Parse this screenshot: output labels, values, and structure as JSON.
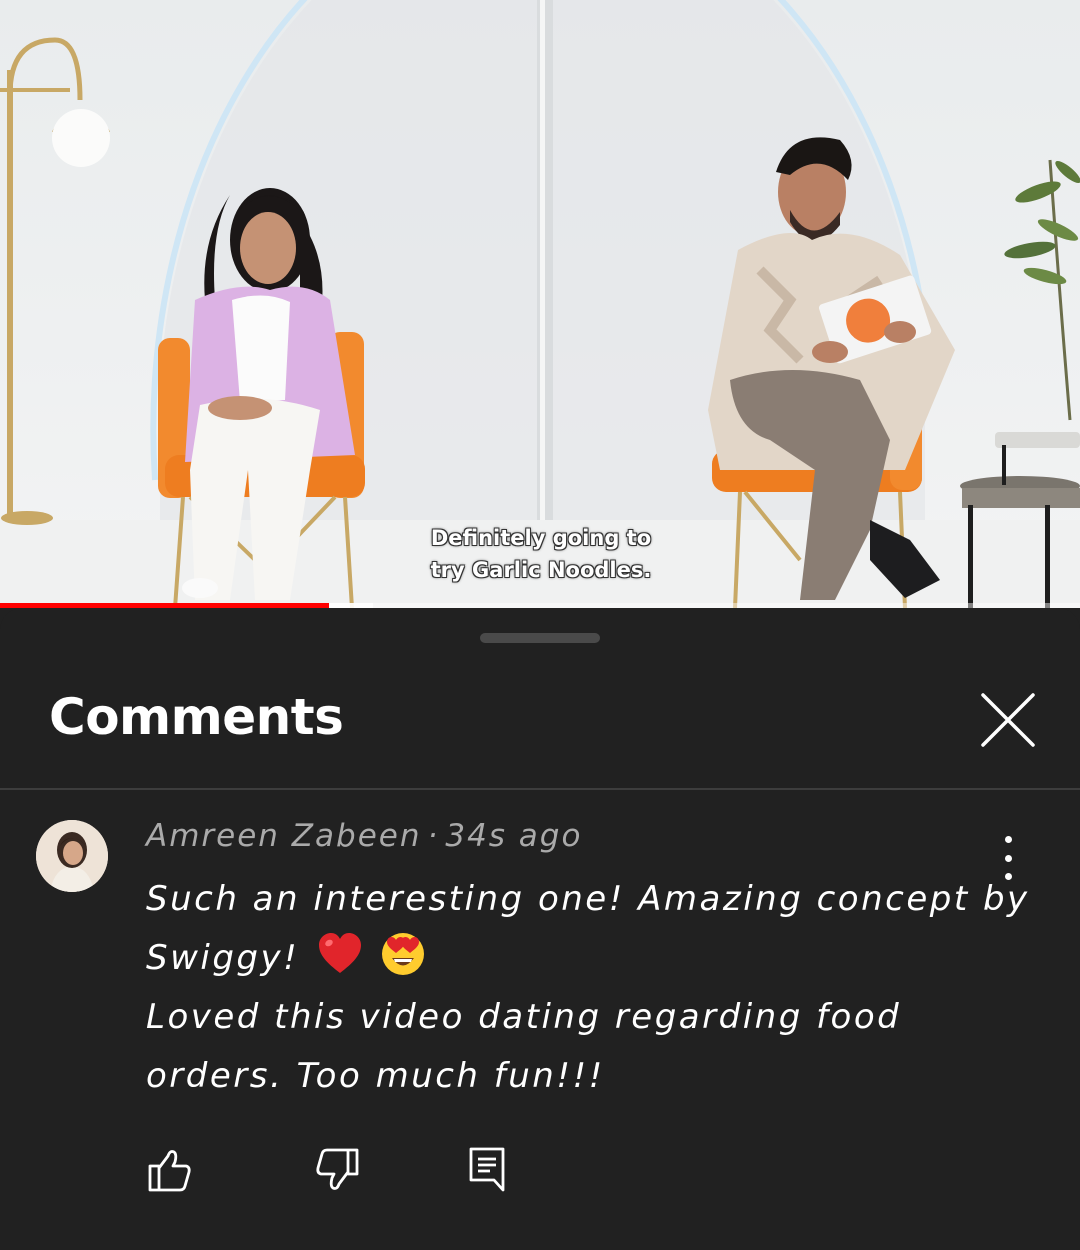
{
  "video": {
    "subtitle_line1": "Definitely going to",
    "subtitle_line2": "try Garlic Noodles.",
    "progress_played_fraction": 0.305,
    "progress_buffered_fraction": 0.345
  },
  "comments_panel": {
    "title": "Comments",
    "close_icon": "close-icon"
  },
  "comment": {
    "author": "Amreen Zabeen",
    "separator": "·",
    "time_ago": "34s ago",
    "text_line1": "Such an interesting one! Amazing concept by",
    "text_line2": "Swiggy!",
    "text_line3": "Loved this video dating regarding food",
    "text_line4": "orders. Too much fun!!!",
    "emojis": [
      "red-heart-emoji",
      "heart-eyes-emoji"
    ],
    "actions": [
      "like-icon",
      "dislike-icon",
      "reply-icon"
    ]
  },
  "colors": {
    "panel_background": "#212121",
    "progress_red": "#ff0000",
    "meta_gray": "#aaaaaa",
    "text_white": "#ffffff"
  }
}
